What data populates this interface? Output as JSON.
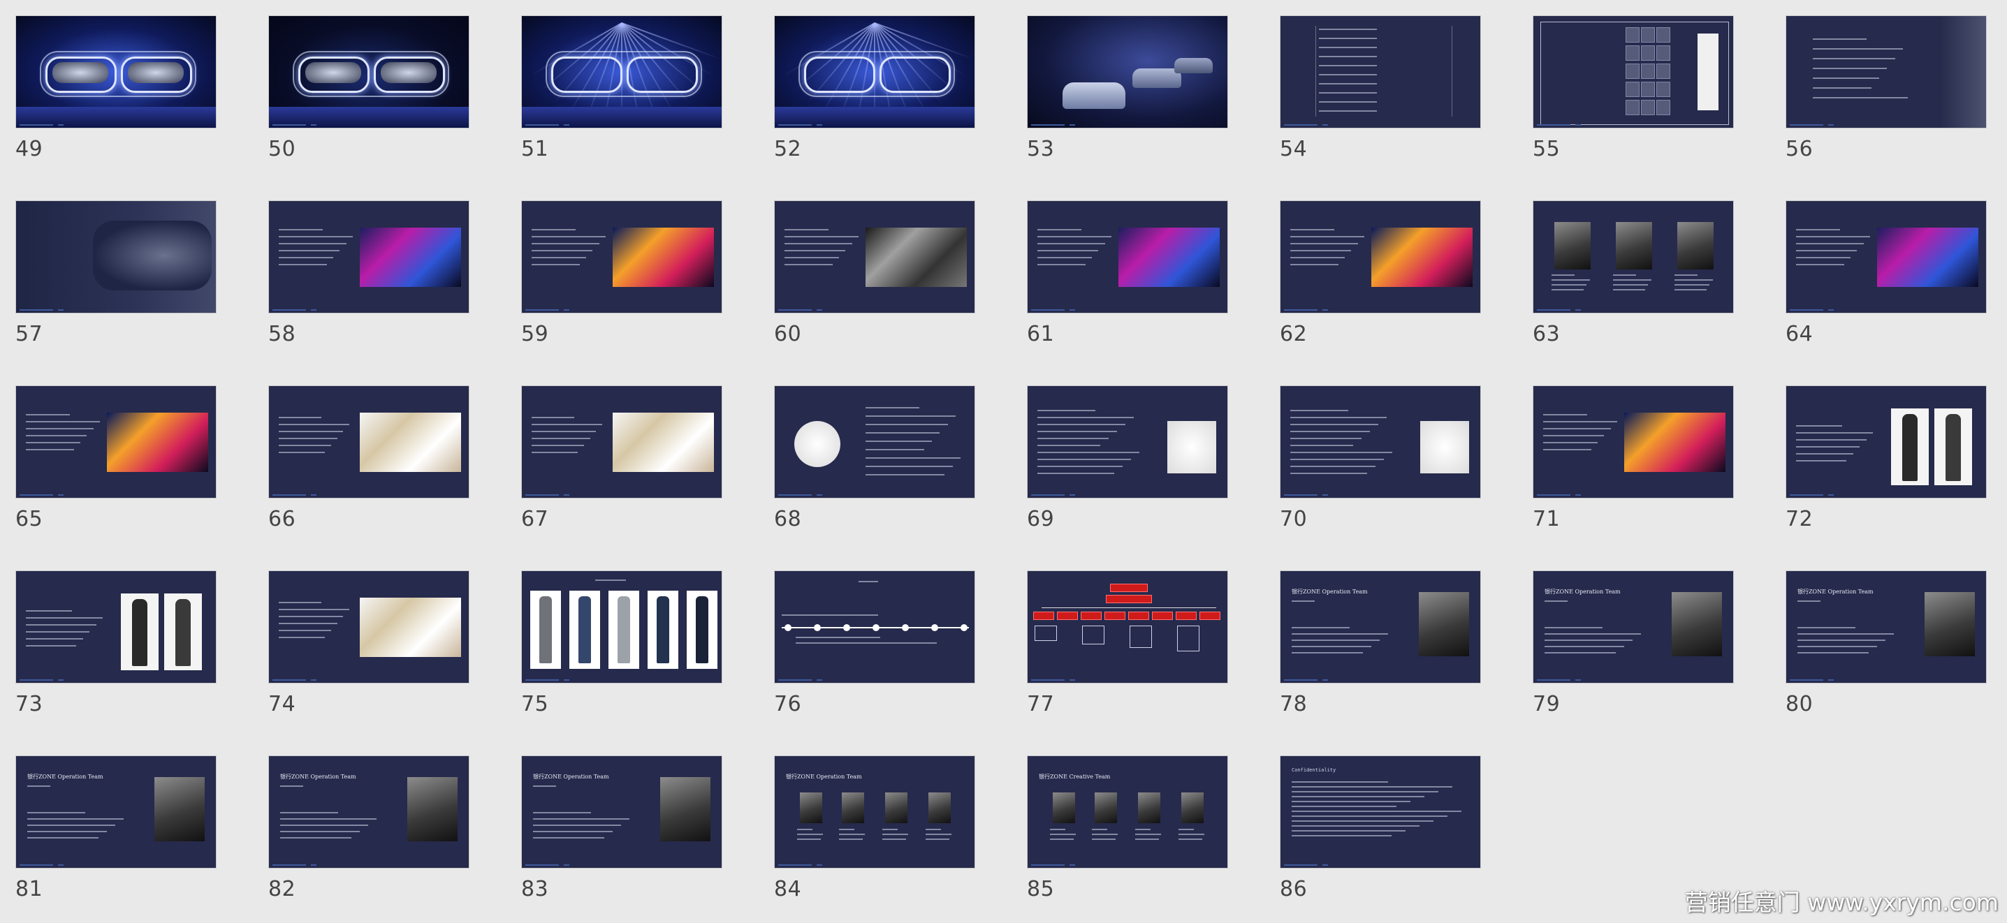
{
  "slides": [
    {
      "number": "49",
      "kind": "stage"
    },
    {
      "number": "50",
      "kind": "stage-dark"
    },
    {
      "number": "51",
      "kind": "stage-beams"
    },
    {
      "number": "52",
      "kind": "stage-beams"
    },
    {
      "number": "53",
      "kind": "cars"
    },
    {
      "number": "54",
      "kind": "schedule"
    },
    {
      "number": "55",
      "kind": "floorplan"
    },
    {
      "number": "56",
      "kind": "bullets"
    },
    {
      "number": "57",
      "kind": "car-dark"
    },
    {
      "number": "58",
      "kind": "text-photo"
    },
    {
      "number": "59",
      "kind": "text-photo"
    },
    {
      "number": "60",
      "kind": "text-photo"
    },
    {
      "number": "61",
      "kind": "text-photo"
    },
    {
      "number": "62",
      "kind": "text-photo"
    },
    {
      "number": "63",
      "kind": "three-portraits"
    },
    {
      "number": "64",
      "kind": "text-photo"
    },
    {
      "number": "65",
      "kind": "text-photo"
    },
    {
      "number": "66",
      "kind": "text-photo-white"
    },
    {
      "number": "67",
      "kind": "text-photo-white"
    },
    {
      "number": "68",
      "kind": "circle-text"
    },
    {
      "number": "69",
      "kind": "text-figure"
    },
    {
      "number": "70",
      "kind": "text-figure"
    },
    {
      "number": "71",
      "kind": "text-photo"
    },
    {
      "number": "72",
      "kind": "text-models"
    },
    {
      "number": "73",
      "kind": "text-models"
    },
    {
      "number": "74",
      "kind": "text-photo-white"
    },
    {
      "number": "75",
      "kind": "suits"
    },
    {
      "number": "76",
      "kind": "timeline"
    },
    {
      "number": "77",
      "kind": "orgchart"
    },
    {
      "number": "78",
      "kind": "team-portrait"
    },
    {
      "number": "79",
      "kind": "team-portrait"
    },
    {
      "number": "80",
      "kind": "team-portrait"
    },
    {
      "number": "81",
      "kind": "team-portrait"
    },
    {
      "number": "82",
      "kind": "team-portrait"
    },
    {
      "number": "83",
      "kind": "team-portrait"
    },
    {
      "number": "84",
      "kind": "team-four"
    },
    {
      "number": "85",
      "kind": "team-four"
    },
    {
      "number": "86",
      "kind": "confidentiality"
    }
  ],
  "slide_titles": {
    "78": "银行ZONE Operation Team",
    "79": "银行ZONE Operation Team",
    "80": "银行ZONE Operation Team",
    "81": "银行ZONE Operation Team",
    "82": "银行ZONE Operation Team",
    "83": "银行ZONE Operation Team",
    "84": "银行ZONE Operation Team",
    "85": "银行ZONE Creative Team",
    "86": "Confidentiality"
  },
  "watermark": "营销任意门 www.yxrym.com",
  "colors": {
    "slide_bg": "#262a4c",
    "page_bg": "#e9e9ea",
    "accent_red": "#d01b1b",
    "footer_bar": "#3e5a9c"
  }
}
